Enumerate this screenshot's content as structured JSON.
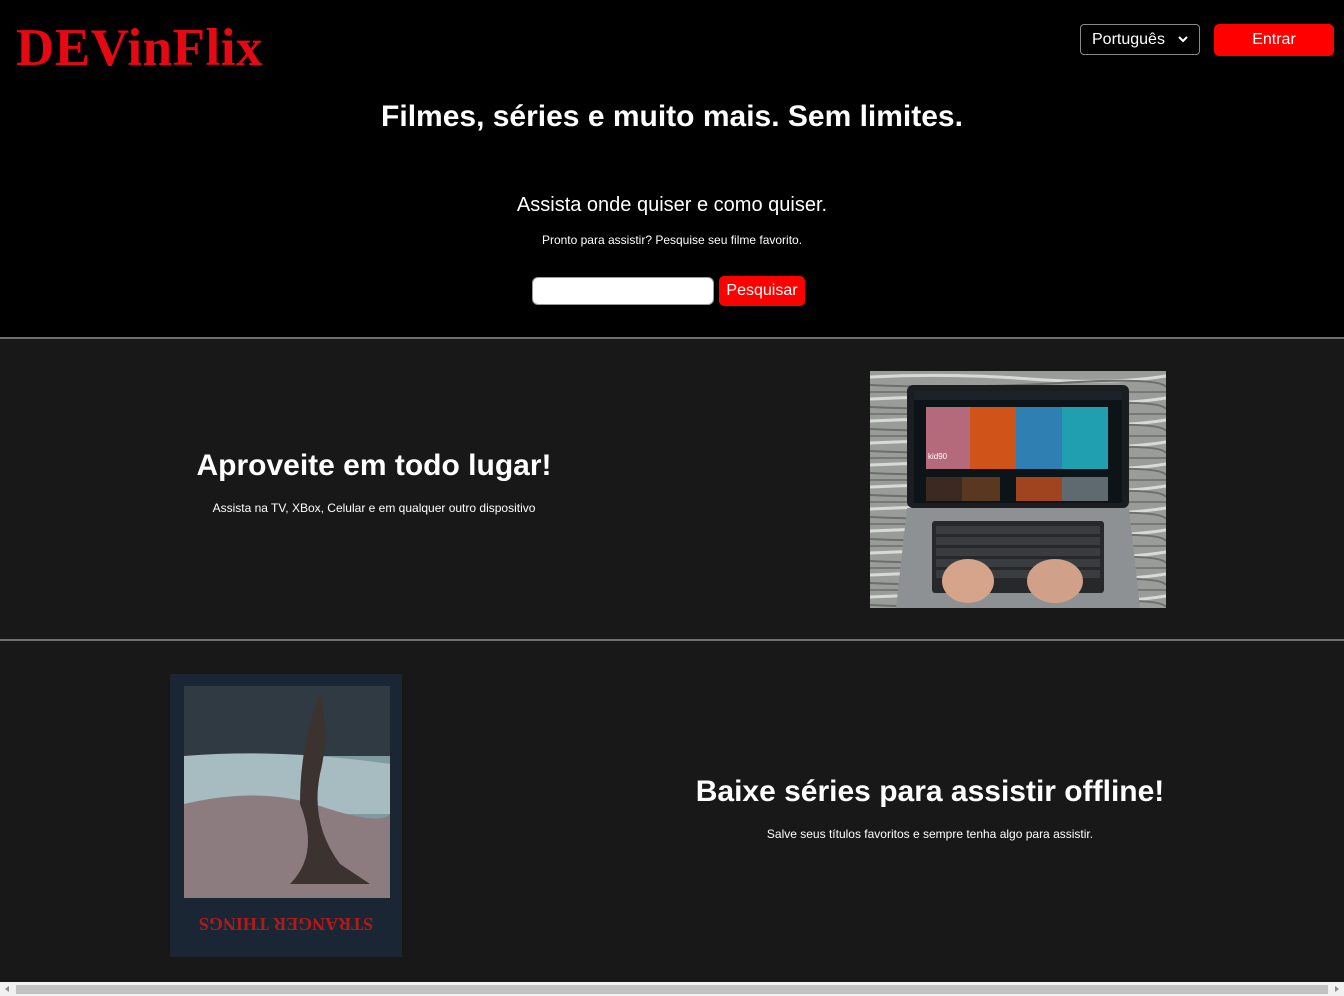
{
  "header": {
    "logo": "DEVinFlix",
    "language_select": {
      "selected": "Português"
    },
    "enter_label": "Entrar"
  },
  "hero": {
    "title": "Filmes, séries e muito mais. Sem limites.",
    "subtitle": "Assista onde quiser e como quiser.",
    "prompt": "Pronto para assistir? Pesquise seu filme favorito.",
    "search": {
      "value": "",
      "placeholder": ""
    },
    "search_button": "Pesquisar"
  },
  "section_anywhere": {
    "title": "Aproveite em todo lugar!",
    "text": "Assista na TV, XBox, Celular e em qualquer outro dispositivo",
    "laptop_screen_label": "kid90"
  },
  "section_download": {
    "title": "Baixe séries para assistir offline!",
    "text": "Salve seus títulos favoritos e sempre tenha algo para assistir.",
    "poster_logo": "STRANGER THINGS"
  },
  "colors": {
    "brand_red": "#e50914",
    "button_red": "#ff0000",
    "hero_bg": "#000000",
    "section_bg": "#181818",
    "divider": "#6e6e6e"
  },
  "icons": {
    "language_chevron": "chevron-down-icon",
    "scroll_left": "arrow-left-icon",
    "scroll_right": "arrow-right-icon"
  }
}
